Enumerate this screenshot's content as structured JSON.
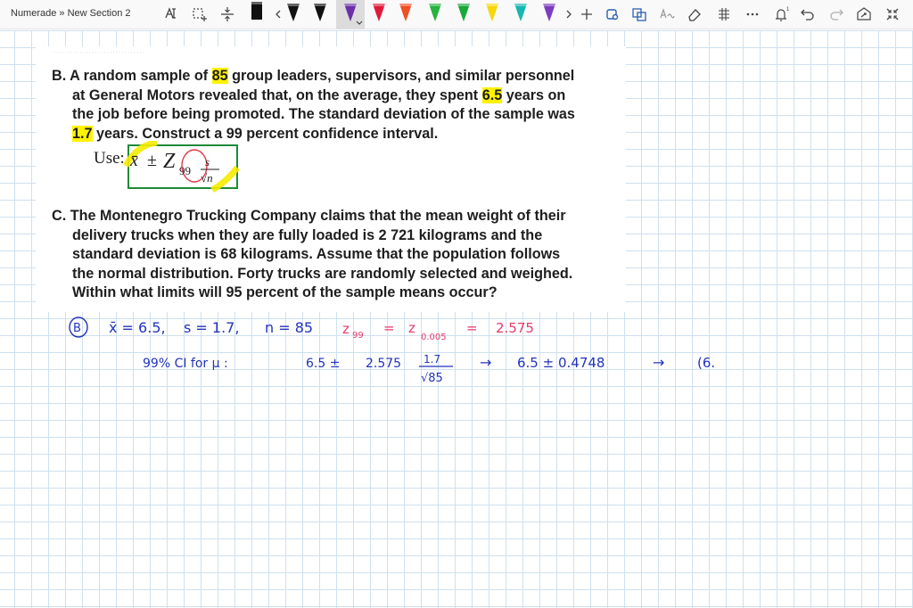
{
  "toolbar": {
    "title": "Numerade » New Section 2",
    "tools": [
      "lasso-select-icon",
      "add-space-icon",
      "insert-space-icon"
    ],
    "pens": [
      {
        "name": "pen-black",
        "color": "#111111"
      },
      {
        "name": "pen-black-2",
        "color": "#111111"
      },
      {
        "name": "pen-black-3",
        "color": "#111111"
      },
      {
        "name": "pen-purple",
        "color": "#6b2fa8"
      },
      {
        "name": "pen-red",
        "color": "#e0193a"
      },
      {
        "name": "pen-orange",
        "color": "#ef4f22"
      },
      {
        "name": "pen-green",
        "color": "#27b33e"
      },
      {
        "name": "pen-green-2",
        "color": "#1aa83a"
      },
      {
        "name": "pen-yellow",
        "color": "#f5d70a"
      },
      {
        "name": "pen-teal",
        "color": "#17b6b3"
      },
      {
        "name": "pen-purple-2",
        "color": "#7d3cc0"
      }
    ],
    "right_icons": [
      "add-pen-icon",
      "ruler-icon",
      "ink-to-shape-icon",
      "ink-to-text-icon",
      "eraser-icon",
      "ink-replay-icon",
      "more-icon",
      "tips-icon",
      "undo-icon",
      "redo-icon",
      "share-icon",
      "full-screen-icon"
    ]
  },
  "problem_b": {
    "label": "B.",
    "line1_pre": "A random sample of ",
    "line1_hl": "85",
    "line1_post": " group leaders, supervisors, and similar personnel",
    "line2_pre": "at General Motors revealed that, on the average, they spent ",
    "line2_hl": "6.5",
    "line2_post": " years on",
    "line3": "the job before being promoted. The standard deviation of the sample was",
    "line4_hl": "1.7",
    "line4_post": " years. Construct a 99 percent confidence interval.",
    "formula_use": "Use:",
    "formula_xbar": "x̄",
    "formula_pm": "±",
    "formula_z": "Z",
    "formula_sub": "99",
    "formula_num": "s",
    "formula_den": "√n"
  },
  "problem_c": {
    "label": "C.",
    "lines": [
      "The Montenegro Trucking Company claims that the mean weight of their",
      "delivery trucks when they are fully loaded is 2 721 kilograms and the",
      "standard deviation is 68 kilograms. Assume that the population follows",
      "the normal distribution. Forty trucks are randomly selected and weighed.",
      "Within what limits will 95 percent of the sample means occur?"
    ]
  },
  "handwriting": {
    "label": "B",
    "given_xbar": "x̄ = 6.5,",
    "given_s": "s = 1.7,",
    "given_n": "n = 85",
    "z_lhs": "z",
    "z_lhs_sub": "99",
    "z_eq1": "=",
    "z_mid": "z",
    "z_mid_sub": "0.005",
    "z_eq2": "=",
    "z_val": "2.575",
    "ci_label": "99% CI for μ :",
    "ci_expr": "6.5 ±",
    "ci_z": "2.575",
    "ci_num": "1.7",
    "ci_den": "√85",
    "arrow1": "→",
    "ci_result": "6.5 ± 0.4748",
    "arrow2": "→",
    "ci_final": "(6."
  }
}
